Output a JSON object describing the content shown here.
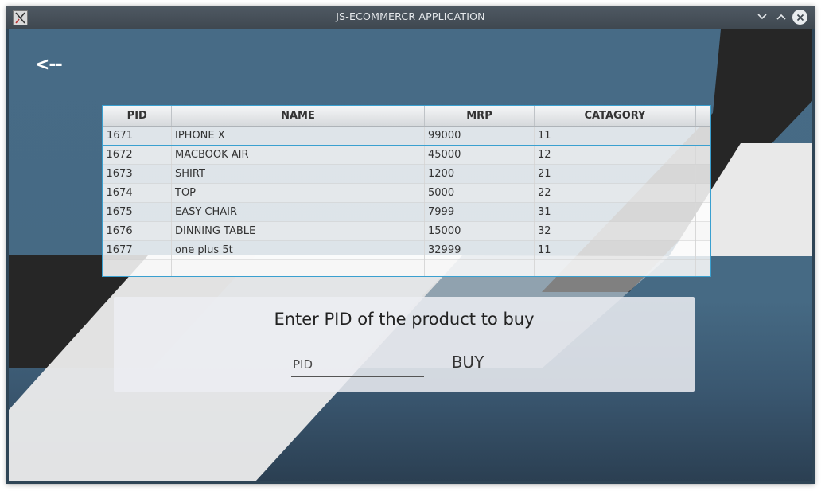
{
  "window": {
    "title": "JS-ECOMMERCR APPLICATION"
  },
  "nav": {
    "back_label": "<--"
  },
  "table": {
    "columns": [
      "PID",
      "NAME",
      "MRP",
      "CATAGORY"
    ],
    "rows": [
      {
        "pid": "1671",
        "name": "IPHONE X",
        "mrp": "99000",
        "category": "11"
      },
      {
        "pid": "1672",
        "name": "MACBOOK AIR",
        "mrp": "45000",
        "category": "12"
      },
      {
        "pid": "1673",
        "name": "SHIRT",
        "mrp": "1200",
        "category": "21"
      },
      {
        "pid": "1674",
        "name": "TOP",
        "mrp": "5000",
        "category": "22"
      },
      {
        "pid": "1675",
        "name": "EASY CHAIR",
        "mrp": "7999",
        "category": "31"
      },
      {
        "pid": "1676",
        "name": "DINNING TABLE",
        "mrp": "15000",
        "category": "32"
      },
      {
        "pid": "1677",
        "name": "one plus 5t",
        "mrp": "32999",
        "category": "11"
      }
    ],
    "selected_row": 0
  },
  "buy": {
    "prompt": "Enter PID of the product to buy",
    "pid_placeholder": "PID",
    "pid_value": "",
    "button_label": "BUY"
  },
  "theme": {
    "accent": "#3aa0d0",
    "background": "#476b86",
    "stripe_dark": "#262626",
    "stripe_light": "#e9e9e9"
  }
}
